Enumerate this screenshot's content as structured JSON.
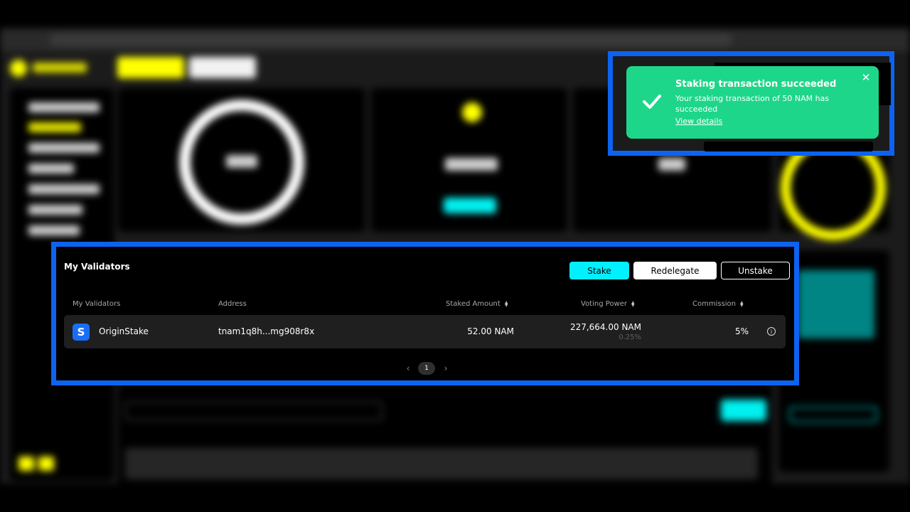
{
  "validators_panel": {
    "title": "My Validators",
    "actions": {
      "stake": "Stake",
      "redelegate": "Redelegate",
      "unstake": "Unstake"
    },
    "columns": {
      "validator": "My Validators",
      "address": "Address",
      "staked_amount": "Staked Amount",
      "voting_power": "Voting Power",
      "commission": "Commission"
    },
    "rows": [
      {
        "logo_letter": "S",
        "name": "OriginStake",
        "address": "tnam1q8h...mg908r8x",
        "staked_amount": "52.00 NAM",
        "voting_power": "227,664.00 NAM",
        "voting_power_pct": "0.25%",
        "commission": "5%",
        "icon": "info-icon"
      }
    ],
    "pagination": {
      "current_page": "1",
      "prev_icon": "chevron-left-icon",
      "next_icon": "chevron-right-icon"
    }
  },
  "toast": {
    "title": "Staking transaction succeeded",
    "message": "Your staking transaction of 50 NAM has succeeded",
    "link": "View details",
    "close_icon": "close-icon",
    "status_icon": "check-icon",
    "color": "#1ed68a"
  },
  "colors": {
    "highlight_frame": "#0d63f0",
    "accent_cyan": "#00f0ff",
    "brand_yellow": "#ffff00",
    "validator_logo": "#1a6ef5"
  }
}
